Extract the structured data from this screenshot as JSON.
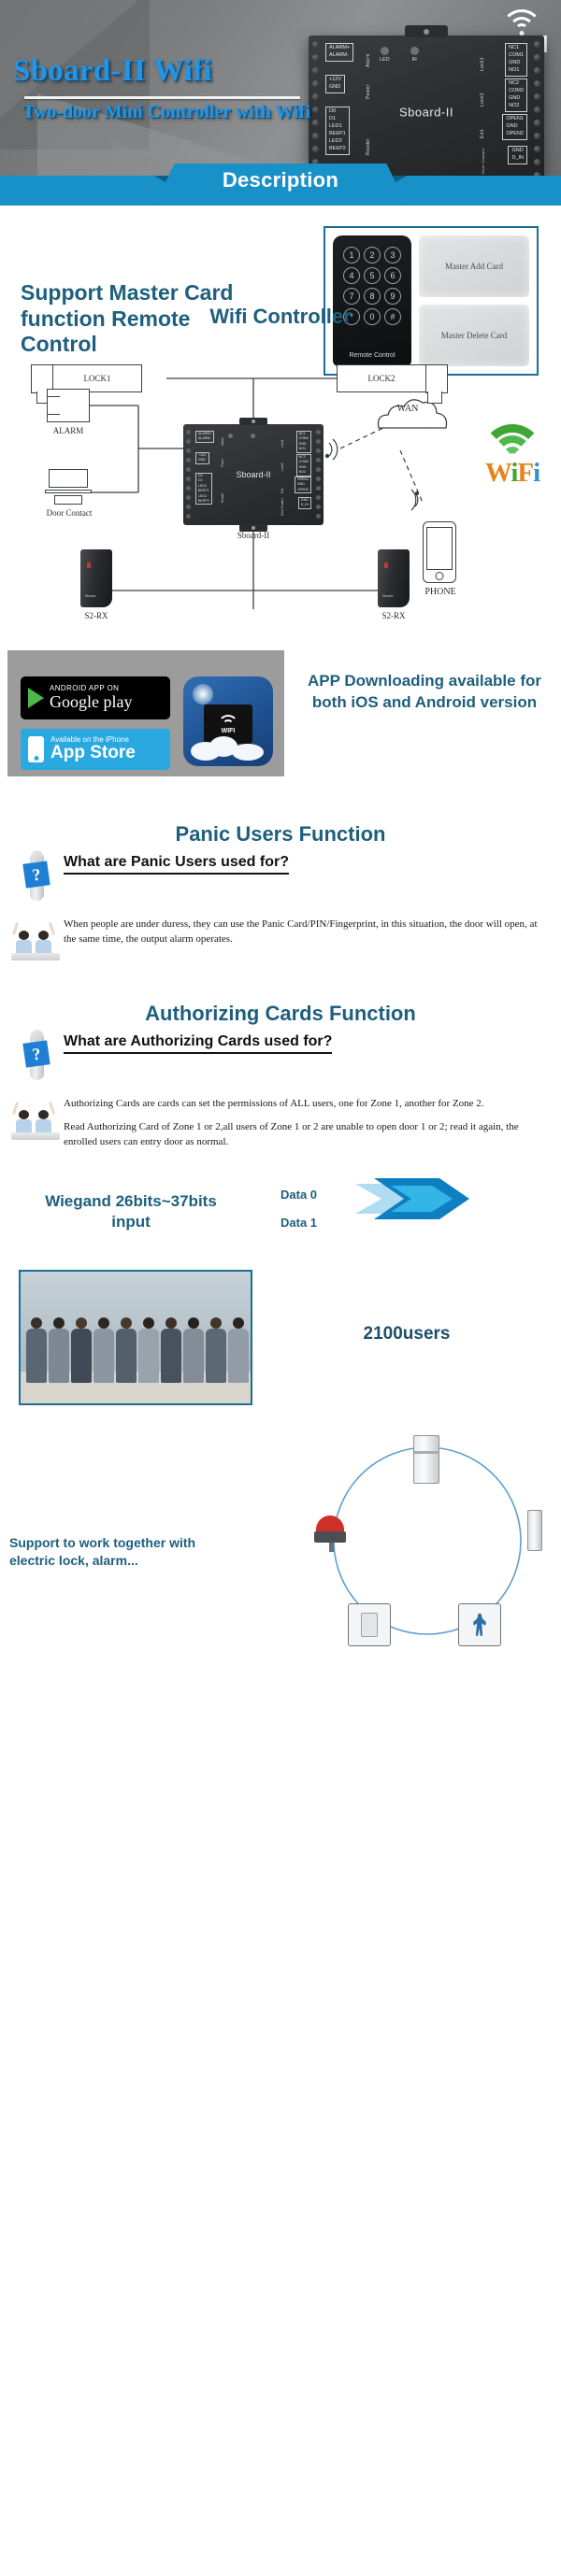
{
  "hero": {
    "title": "Sboard-II Wifi",
    "subtitle": "Two-door Mini Controller with Wifi",
    "wifi_label": "WIFI",
    "device": {
      "brand": "Sboard-II",
      "led_label": "LED",
      "ir_label": "IR",
      "groups": {
        "alarm": {
          "side": "Alarm",
          "pins": [
            "ALARM+",
            "ALARM-"
          ]
        },
        "power": {
          "side": "Power",
          "pins": [
            "+12V",
            "GND"
          ]
        },
        "reader": {
          "side": "Reader",
          "pins": [
            "D0",
            "D1",
            "LED1",
            "BEEP1",
            "LED2",
            "BEEP2"
          ]
        },
        "lock1": {
          "side": "Lock1",
          "pins": [
            "NC1",
            "COM1",
            "GND",
            "NO1"
          ]
        },
        "lock2": {
          "side": "Lock2",
          "pins": [
            "NC2",
            "COM2",
            "GND",
            "NO2"
          ]
        },
        "exit": {
          "side": "Exit",
          "pins": [
            "OPEN1",
            "GND",
            "OPEN2"
          ]
        },
        "door_contact": {
          "side": "Door Contact",
          "pins": [
            "GND",
            "D_IN"
          ]
        }
      }
    }
  },
  "description_banner": {
    "label": "Description"
  },
  "master_card": {
    "headline": "Support Master Card function Remote Control",
    "remote_label": "Remote Control",
    "keys": [
      "1",
      "2",
      "3",
      "4",
      "5",
      "6",
      "7",
      "8",
      "9",
      "*",
      "0",
      "#"
    ],
    "cards": [
      "Master Add Card",
      "Master Delete Card"
    ]
  },
  "wifi_controller": {
    "title": "Wifi Controller",
    "labels": {
      "lock1": "LOCK1",
      "lock2": "LOCK2",
      "alarm": "ALARM",
      "door_contact": "Door Contact",
      "controller": "Sboard-II",
      "controller_face": "Sboard-II",
      "wan": "WAN",
      "phone": "PHONE",
      "reader_left": "S2-RX",
      "reader_right": "S2-RX",
      "wifi_logo": "WiFi"
    }
  },
  "app_download": {
    "text": "APP Downloading available for both iOS and Android version",
    "google_badge": {
      "small": "ANDROID APP ON",
      "large": "Google play"
    },
    "apple_badge": {
      "small": "Available on the iPhone",
      "large": "App Store"
    },
    "app_icon_label": "WIFI"
  },
  "panic": {
    "title": "Panic Users Function",
    "question": "What are Panic Users used for?",
    "body": [
      "When people are under duress, they can use the Panic Card/PIN/Fingerprint, in this situation, the door will open, at the same time, the output alarm operates."
    ]
  },
  "authorizing": {
    "title": "Authorizing Cards Function",
    "question": "What are Authorizing Cards used for?",
    "body": [
      "Authorizing Cards are cards can set the permissions of ALL users, one for Zone 1, another for Zone 2.",
      "Read Authorizing Card of Zone 1 or 2,all users of Zone 1 or 2 are unable to open door 1 or 2; read it again, the enrolled users can entry door as normal."
    ]
  },
  "wiegand": {
    "spec": "Wiegand 26bits~37bits input",
    "data0": "Data 0",
    "data1": "Data 1"
  },
  "users": {
    "count": "2100users"
  },
  "work_together": {
    "text": "Support to work together with electric lock, alarm..."
  },
  "colors": {
    "brand_blue": "#1890c8",
    "title_teal": "#1d5f7d",
    "hero_title_blue": "#2196e8",
    "accent_dark": "#0d5f86"
  }
}
